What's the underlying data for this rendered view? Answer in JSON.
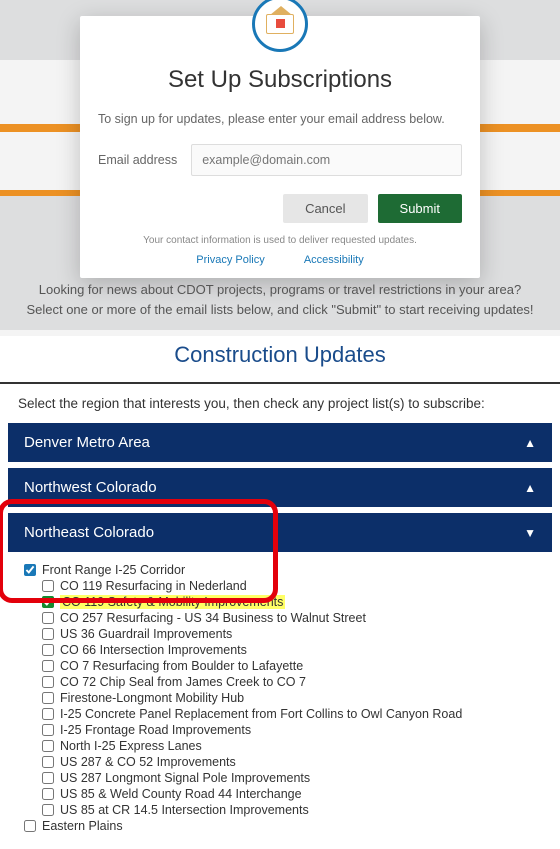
{
  "modal": {
    "title": "Set Up Subscriptions",
    "instruction": "To sign up for updates, please enter your email address below.",
    "email_label": "Email address",
    "email_placeholder": "example@domain.com",
    "cancel_label": "Cancel",
    "submit_label": "Submit",
    "fine_print": "Your contact information is used to deliver requested updates.",
    "privacy_link": "Privacy Policy",
    "accessibility_link": "Accessibility"
  },
  "intro": "Looking for news about CDOT projects, programs or travel restrictions in your area? Select one or more of the email lists below, and click \"Submit\" to start receiving updates!",
  "section_title": "Construction Updates",
  "select_instruction": "Select the region that interests you, then check any project list(s) to subscribe:",
  "accordions": {
    "denver": {
      "label": "Denver Metro Area",
      "expanded": false
    },
    "northwest": {
      "label": "Northwest Colorado",
      "expanded": false
    },
    "northeast": {
      "label": "Northeast Colorado",
      "expanded": true
    }
  },
  "northeast_tree": {
    "group1": {
      "label": "Front Range I-25 Corridor",
      "checked": true,
      "items": [
        {
          "label": "CO 119 Resurfacing in Nederland",
          "checked": false,
          "highlight": false
        },
        {
          "label": "CO 119 Safety & Mobility Improvements",
          "checked": true,
          "highlight": true
        },
        {
          "label": "CO 257 Resurfacing - US 34 Business to Walnut Street",
          "checked": false
        },
        {
          "label": "US 36 Guardrail Improvements",
          "checked": false
        },
        {
          "label": "CO 66 Intersection Improvements",
          "checked": false
        },
        {
          "label": "CO 7 Resurfacing from Boulder to Lafayette",
          "checked": false
        },
        {
          "label": "CO 72 Chip Seal from James Creek to CO 7",
          "checked": false
        },
        {
          "label": "Firestone-Longmont Mobility Hub",
          "checked": false
        },
        {
          "label": "I-25 Concrete Panel Replacement from Fort Collins to Owl Canyon Road",
          "checked": false
        },
        {
          "label": "I-25 Frontage Road Improvements",
          "checked": false
        },
        {
          "label": "North I-25 Express Lanes",
          "checked": false
        },
        {
          "label": "US 287 & CO 52 Improvements",
          "checked": false
        },
        {
          "label": "US 287 Longmont Signal Pole Improvements",
          "checked": false
        },
        {
          "label": "US 85 & Weld County Road 44 Interchange",
          "checked": false
        },
        {
          "label": "US 85 at CR 14.5 Intersection Improvements",
          "checked": false
        }
      ]
    },
    "group2": {
      "label": "Eastern Plains",
      "checked": false
    }
  },
  "colors": {
    "accent_blue": "#1978B7",
    "nav_blue": "#0C2F69",
    "submit_green": "#1E6B34",
    "highlight_red": "#E3000B"
  }
}
